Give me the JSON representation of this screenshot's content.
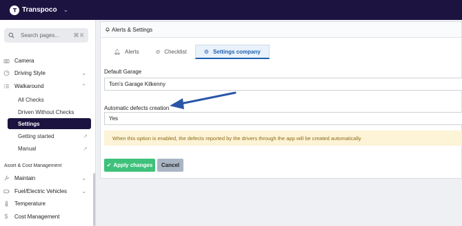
{
  "app": {
    "brand": "Transpoco"
  },
  "sidebar": {
    "search_placeholder": "Search pages...",
    "search_shortcut": "⌘ K",
    "items": {
      "camera": "Camera",
      "driving_style": "Driving Style",
      "walkaround": "Walkaround",
      "all_checks": "All Checks",
      "driven_without_checks": "Driven Without Checks",
      "settings": "Settings",
      "getting_started": "Getting started",
      "manual": "Manual",
      "section_asset": "Asset & Cost Management",
      "maintain": "Maintain",
      "fuel": "Fuel/Electric Vehicles",
      "temperature": "Temperature",
      "cost_management": "Cost Management"
    }
  },
  "panel": {
    "title": "Alerts & Settings",
    "tabs": [
      {
        "label": "Alerts",
        "icon": "bell-icon",
        "active": false
      },
      {
        "label": "Checklist",
        "icon": "check-circle-icon",
        "active": false
      },
      {
        "label": "Settings company",
        "icon": "gear-icon",
        "active": true
      }
    ],
    "default_garage_label": "Default Garage",
    "default_garage_value": "Tom's Garage Kilkenny",
    "auto_defects_label": "Automatic defects creation",
    "auto_defects_value": "Yes",
    "notice": "When this option is enabled, the defects reported by the drivers through the app will be created automatically",
    "apply_label": "Apply changes",
    "cancel_label": "Cancel"
  },
  "colors": {
    "topbar": "#1c1340",
    "active_nav": "#1c1340",
    "accent_blue": "#1f5fad",
    "apply_green": "#3ec17a",
    "notice_bg": "#fdf3d6",
    "annotation_arrow": "#2a55a6"
  }
}
